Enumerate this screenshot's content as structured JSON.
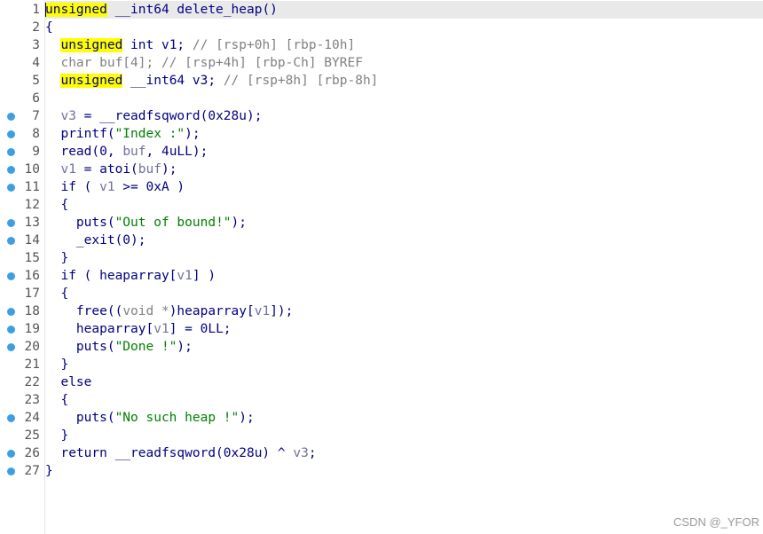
{
  "colors": {
    "keyword_highlight": "#ffff00",
    "comment": "#808080",
    "string": "#008000",
    "variable": "#7070a0",
    "default": "#000080",
    "breakpoint_dot": "#3d9ee6",
    "current_line": "#e9e9e9"
  },
  "lines": [
    {
      "num": "1",
      "dot": false,
      "current": true,
      "tokens": [
        {
          "t": "unsigned",
          "c": "kw-hl"
        },
        {
          "t": " __int64 delete_heap()",
          "c": "def"
        }
      ]
    },
    {
      "num": "2",
      "dot": false,
      "tokens": [
        {
          "t": "{",
          "c": "def"
        }
      ]
    },
    {
      "num": "3",
      "dot": false,
      "tokens": [
        {
          "t": "  ",
          "c": "def"
        },
        {
          "t": "unsigned",
          "c": "kw-hl"
        },
        {
          "t": " int v1; ",
          "c": "def"
        },
        {
          "t": "// [rsp+0h] [rbp-10h]",
          "c": "cmt"
        }
      ]
    },
    {
      "num": "4",
      "dot": false,
      "tokens": [
        {
          "t": "  char buf[4]; ",
          "c": "cmt"
        },
        {
          "t": "// [rsp+4h] [rbp-Ch] BYREF",
          "c": "cmt"
        }
      ]
    },
    {
      "num": "5",
      "dot": false,
      "tokens": [
        {
          "t": "  ",
          "c": "def"
        },
        {
          "t": "unsigned",
          "c": "kw-hl"
        },
        {
          "t": " __int64 v3; ",
          "c": "def"
        },
        {
          "t": "// [rsp+8h] [rbp-8h]",
          "c": "cmt"
        }
      ]
    },
    {
      "num": "6",
      "dot": false,
      "tokens": []
    },
    {
      "num": "7",
      "dot": true,
      "tokens": [
        {
          "t": "  ",
          "c": "def"
        },
        {
          "t": "v3",
          "c": "var"
        },
        {
          "t": " = __readfsqword(0x28u);",
          "c": "def"
        }
      ]
    },
    {
      "num": "8",
      "dot": true,
      "tokens": [
        {
          "t": "  printf(",
          "c": "def"
        },
        {
          "t": "\"Index :\"",
          "c": "str"
        },
        {
          "t": ");",
          "c": "def"
        }
      ]
    },
    {
      "num": "9",
      "dot": true,
      "tokens": [
        {
          "t": "  read(0, ",
          "c": "def"
        },
        {
          "t": "buf",
          "c": "var"
        },
        {
          "t": ", 4uLL);",
          "c": "def"
        }
      ]
    },
    {
      "num": "10",
      "dot": true,
      "tokens": [
        {
          "t": "  ",
          "c": "def"
        },
        {
          "t": "v1",
          "c": "var"
        },
        {
          "t": " = atoi(",
          "c": "def"
        },
        {
          "t": "buf",
          "c": "var"
        },
        {
          "t": ");",
          "c": "def"
        }
      ]
    },
    {
      "num": "11",
      "dot": true,
      "tokens": [
        {
          "t": "  if ( ",
          "c": "def"
        },
        {
          "t": "v1",
          "c": "var"
        },
        {
          "t": " >= 0xA )",
          "c": "def"
        }
      ]
    },
    {
      "num": "12",
      "dot": false,
      "tokens": [
        {
          "t": "  {",
          "c": "def"
        }
      ]
    },
    {
      "num": "13",
      "dot": true,
      "tokens": [
        {
          "t": "    puts(",
          "c": "def"
        },
        {
          "t": "\"Out of bound!\"",
          "c": "str"
        },
        {
          "t": ");",
          "c": "def"
        }
      ]
    },
    {
      "num": "14",
      "dot": true,
      "tokens": [
        {
          "t": "    _exit(0);",
          "c": "def"
        }
      ]
    },
    {
      "num": "15",
      "dot": false,
      "tokens": [
        {
          "t": "  }",
          "c": "def"
        }
      ]
    },
    {
      "num": "16",
      "dot": true,
      "tokens": [
        {
          "t": "  if ( heaparray[",
          "c": "def"
        },
        {
          "t": "v1",
          "c": "var"
        },
        {
          "t": "] )",
          "c": "def"
        }
      ]
    },
    {
      "num": "17",
      "dot": false,
      "tokens": [
        {
          "t": "  {",
          "c": "def"
        }
      ]
    },
    {
      "num": "18",
      "dot": true,
      "tokens": [
        {
          "t": "    free((",
          "c": "def"
        },
        {
          "t": "void *",
          "c": "cmt"
        },
        {
          "t": ")heaparray[",
          "c": "def"
        },
        {
          "t": "v1",
          "c": "var"
        },
        {
          "t": "]);",
          "c": "def"
        }
      ]
    },
    {
      "num": "19",
      "dot": true,
      "tokens": [
        {
          "t": "    heaparray[",
          "c": "def"
        },
        {
          "t": "v1",
          "c": "var"
        },
        {
          "t": "] = 0LL;",
          "c": "def"
        }
      ]
    },
    {
      "num": "20",
      "dot": true,
      "tokens": [
        {
          "t": "    puts(",
          "c": "def"
        },
        {
          "t": "\"Done !\"",
          "c": "str"
        },
        {
          "t": ");",
          "c": "def"
        }
      ]
    },
    {
      "num": "21",
      "dot": false,
      "tokens": [
        {
          "t": "  }",
          "c": "def"
        }
      ]
    },
    {
      "num": "22",
      "dot": false,
      "tokens": [
        {
          "t": "  else",
          "c": "def"
        }
      ]
    },
    {
      "num": "23",
      "dot": false,
      "tokens": [
        {
          "t": "  {",
          "c": "def"
        }
      ]
    },
    {
      "num": "24",
      "dot": true,
      "tokens": [
        {
          "t": "    puts(",
          "c": "def"
        },
        {
          "t": "\"No such heap !\"",
          "c": "str"
        },
        {
          "t": ");",
          "c": "def"
        }
      ]
    },
    {
      "num": "25",
      "dot": false,
      "tokens": [
        {
          "t": "  }",
          "c": "def"
        }
      ]
    },
    {
      "num": "26",
      "dot": true,
      "tokens": [
        {
          "t": "  return __readfsqword(0x28u) ^ ",
          "c": "def"
        },
        {
          "t": "v3",
          "c": "var"
        },
        {
          "t": ";",
          "c": "def"
        }
      ]
    },
    {
      "num": "27",
      "dot": true,
      "tokens": [
        {
          "t": "}",
          "c": "def"
        }
      ]
    }
  ],
  "watermark": "CSDN @_YFOR"
}
